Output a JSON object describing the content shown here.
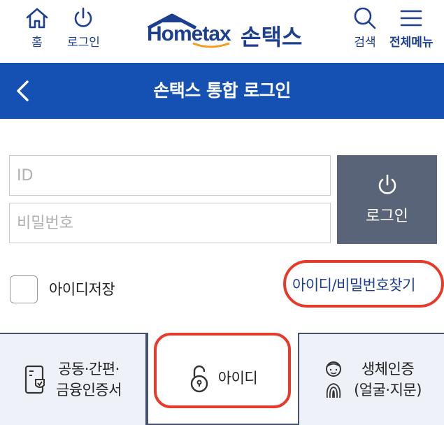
{
  "header": {
    "home_label": "홈",
    "login_label": "로그인",
    "logo_text": "Hometax",
    "logo_korean": "손택스",
    "search_label": "검색",
    "menu_label": "전체메뉴"
  },
  "titlebar": {
    "title": "손택스 통합 로그인"
  },
  "form": {
    "id_placeholder": "ID",
    "password_placeholder": "비밀번호",
    "login_button_label": "로그인",
    "save_id_label": "아이디저장",
    "find_link_label": "아이디/비밀번호찾기"
  },
  "tabs": {
    "certificate": {
      "line1": "공동·간편·",
      "line2": "금융인증서"
    },
    "id": {
      "label": "아이디"
    },
    "biometric": {
      "line1": "생체인증",
      "line2": "(얼굴·지문)"
    }
  },
  "colors": {
    "brand_blue": "#1550b3",
    "header_icon": "#1c3f8f",
    "login_button": "#5a6478",
    "highlight_ring": "#e63a2b"
  }
}
